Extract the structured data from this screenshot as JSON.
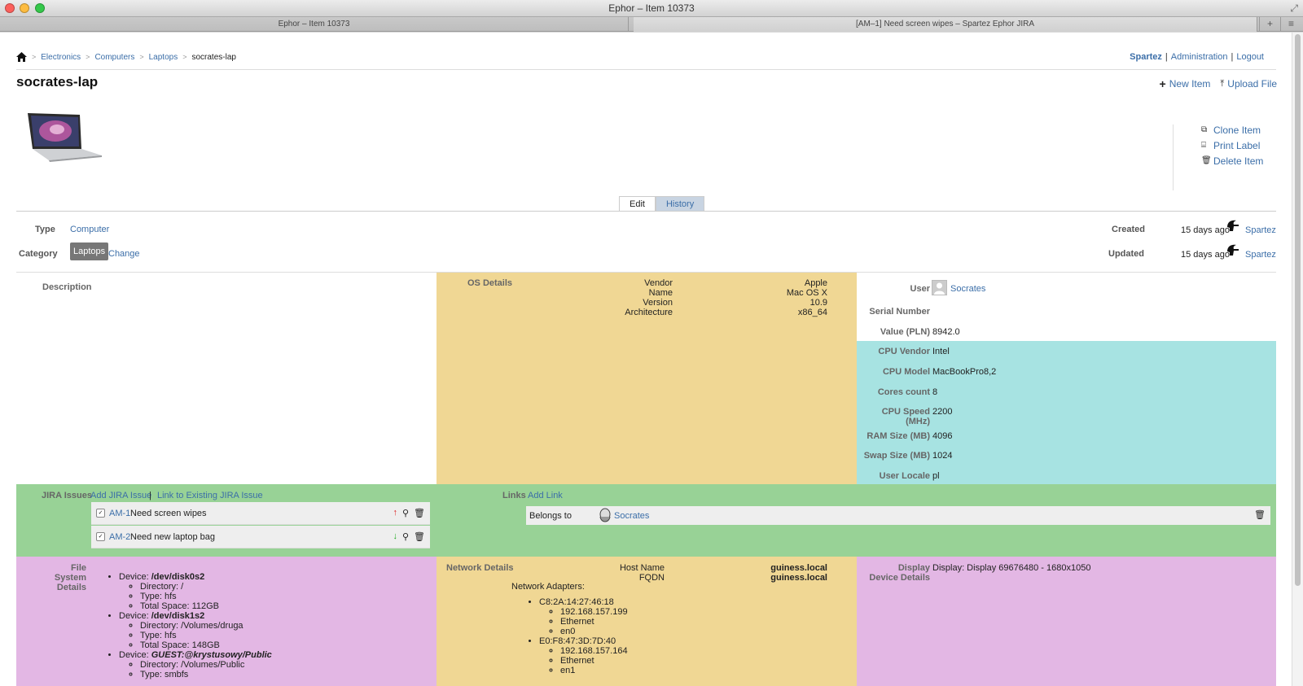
{
  "window": {
    "title": "Ephor – Item 10373",
    "tabs": [
      "Ephor – Item 10373",
      "[AM–1] Need screen wipes – Spartez Ephor JIRA"
    ]
  },
  "breadcrumb": [
    "Electronics",
    "Computers",
    "Laptops",
    "socrates-lap"
  ],
  "top_links": {
    "user": "Spartez",
    "admin": "Administration",
    "logout": "Logout"
  },
  "item": {
    "title": "socrates-lap"
  },
  "actions": {
    "new_item": "New Item",
    "upload_file": "Upload File",
    "clone": "Clone Item",
    "print_label": "Print Label",
    "delete": "Delete Item"
  },
  "tabs": {
    "edit": "Edit",
    "history": "History"
  },
  "props": {
    "type_label": "Type",
    "type_value": "Computer",
    "category_label": "Category",
    "category_value": "Laptops",
    "change": "Change",
    "created_label": "Created",
    "created_value": "15 days ago",
    "created_by": "Spartez",
    "updated_label": "Updated",
    "updated_value": "15 days ago",
    "updated_by": "Spartez"
  },
  "description": {
    "label": "Description"
  },
  "os": {
    "label": "OS Details",
    "keys": [
      "Vendor",
      "Name",
      "Version",
      "Architecture"
    ],
    "values": [
      "Apple",
      "Mac OS X",
      "10.9",
      "x86_64"
    ]
  },
  "fields": {
    "user_label": "User",
    "user_value": "Socrates",
    "serial_label": "Serial Number",
    "value_label": "Value (PLN)",
    "value_value": "8942.0",
    "cpu_vendor_label": "CPU Vendor",
    "cpu_vendor_value": "Intel",
    "cpu_model_label": "CPU Model",
    "cpu_model_value": "MacBookPro8,2",
    "cores_label": "Cores count",
    "cores_value": "8",
    "cpu_speed_label": "CPU Speed (MHz)",
    "cpu_speed_value": "2200",
    "ram_label": "RAM Size (MB)",
    "ram_value": "4096",
    "swap_label": "Swap Size (MB)",
    "swap_value": "1024",
    "locale_label": "User Locale",
    "locale_value": "pl"
  },
  "jira": {
    "label": "JIRA Issues",
    "add": "Add JIRA Issue",
    "link_existing": "Link to Existing JIRA Issue",
    "issues": [
      {
        "key": "AM-1",
        "summary": "Need screen wipes"
      },
      {
        "key": "AM-2",
        "summary": "Need new laptop bag"
      }
    ]
  },
  "links": {
    "label": "Links",
    "add": "Add Link",
    "relation": "Belongs to",
    "target": "Socrates"
  },
  "fs": {
    "label": "File System Details",
    "devices": [
      {
        "device_label": "Device:",
        "name": "/dev/disk0s2",
        "directory": "Directory: /",
        "type": "Type: hfs",
        "total": "Total Space: 112GB"
      },
      {
        "device_label": "Device:",
        "name": "/dev/disk1s2",
        "directory": "Directory: /Volumes/druga",
        "type": "Type: hfs",
        "total": "Total Space: 148GB"
      },
      {
        "device_label": "Device:",
        "name": "GUEST:@krystusowy/Public",
        "directory": "Directory: /Volumes/Public",
        "type": "Type: smbfs"
      }
    ]
  },
  "network": {
    "label": "Network Details",
    "host_label": "Host Name",
    "host_value": "guiness.local",
    "fqdn_label": "FQDN",
    "fqdn_value": "guiness.local",
    "adapters_label": "Network Adapters:",
    "adapters": [
      {
        "mac": "C8:2A:14:27:46:18",
        "ip": "192.168.157.199",
        "kind": "Ethernet",
        "iface": "en0"
      },
      {
        "mac": "E0:F8:47:3D:7D:40",
        "ip": "192.168.157.164",
        "kind": "Ethernet",
        "iface": "en1"
      }
    ]
  },
  "display": {
    "label": "Display Device Details",
    "value": "Display: Display 69676480 - 1680x1050"
  }
}
